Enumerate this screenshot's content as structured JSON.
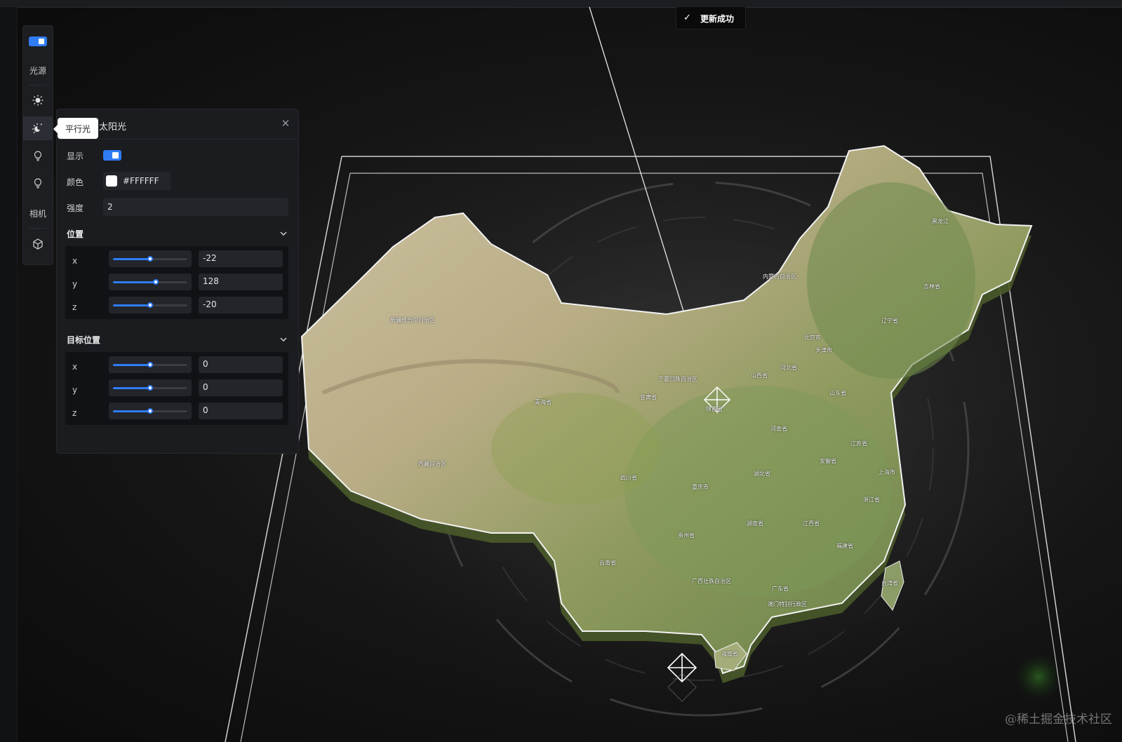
{
  "notification": {
    "text": "更新成功",
    "icon": "check-icon"
  },
  "toolbar": {
    "items": [
      {
        "name": "toggle",
        "icon": "toggle-icon"
      },
      {
        "name": "light-label",
        "label": "光源"
      },
      {
        "name": "ambient-light",
        "icon": "sun-icon"
      },
      {
        "name": "directional-light",
        "icon": "sun-moon-icon",
        "tooltip": "平行光"
      },
      {
        "name": "point-light",
        "icon": "bulb-icon"
      },
      {
        "name": "spot-light",
        "icon": "bulb-icon"
      },
      {
        "name": "camera-label",
        "label": "相机"
      },
      {
        "name": "model",
        "icon": "cube-icon"
      }
    ]
  },
  "panel": {
    "title": "太阳光",
    "show_label": "显示",
    "show_value": true,
    "color_label": "颜色",
    "color_value": "#FFFFFF",
    "intensity_label": "强度",
    "intensity_value": "2",
    "position": {
      "label": "位置",
      "rows": [
        {
          "axis": "x",
          "value": "-22",
          "slider": 0.5
        },
        {
          "axis": "y",
          "value": "128",
          "slider": 0.57
        },
        {
          "axis": "z",
          "value": "-20",
          "slider": 0.5
        }
      ]
    },
    "target": {
      "label": "目标位置",
      "rows": [
        {
          "axis": "x",
          "value": "0",
          "slider": 0.5
        },
        {
          "axis": "y",
          "value": "0",
          "slider": 0.5
        },
        {
          "axis": "z",
          "value": "0",
          "slider": 0.5
        }
      ]
    }
  },
  "map": {
    "labels": [
      "黑龙江",
      "吉林省",
      "辽宁省",
      "内蒙古自治区",
      "北京市",
      "天津市",
      "河北省",
      "山西省",
      "山东省",
      "河南省",
      "江苏省",
      "安徽省",
      "上海市",
      "浙江省",
      "湖北省",
      "重庆市",
      "四川省",
      "湖南省",
      "江西省",
      "福建省",
      "贵州省",
      "云南省",
      "广西壮族自治区",
      "广东省",
      "台湾省",
      "海南省",
      "陕西省",
      "甘肃省",
      "青海省",
      "西藏自治区",
      "新疆维吾尔自治区",
      "宁夏回族自治区",
      "澳门特别行政区"
    ]
  },
  "watermark": "@稀土掘金技术社区",
  "colors": {
    "accent": "#2f7cf6",
    "panel_bg": "#1a1c20"
  }
}
